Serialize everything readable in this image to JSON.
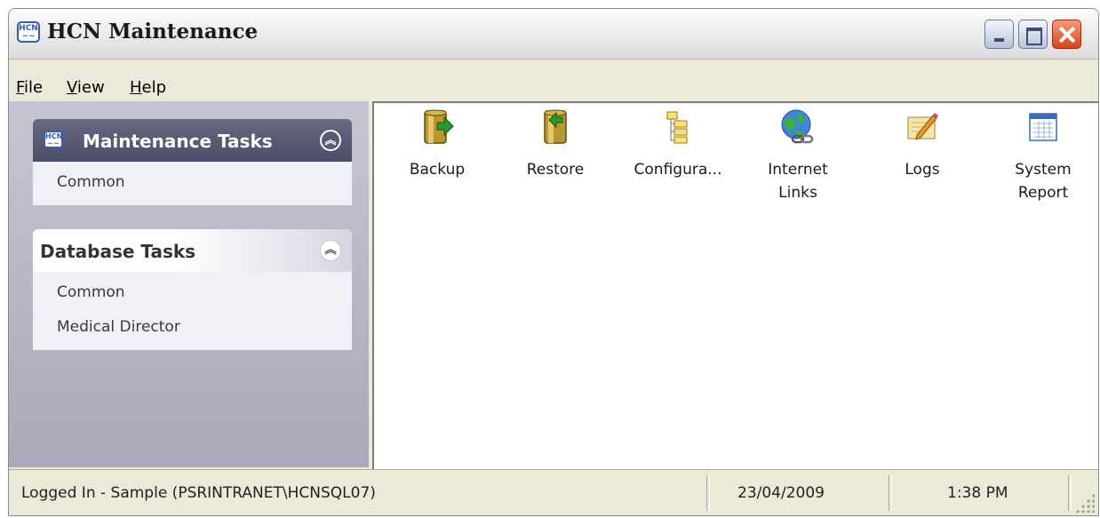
{
  "window": {
    "title": "HCN Maintenance",
    "icon": "hcn-app-icon"
  },
  "menu": {
    "items": [
      {
        "label": "File",
        "mnemonic": "F"
      },
      {
        "label": "View",
        "mnemonic": "V"
      },
      {
        "label": "Help",
        "mnemonic": "H"
      }
    ]
  },
  "sidebar": {
    "panels": [
      {
        "title": "Maintenance Tasks",
        "icon": "hcn-app-icon",
        "items": [
          "Common"
        ]
      },
      {
        "title": "Database Tasks",
        "items": [
          "Common",
          "Medical Director"
        ]
      }
    ]
  },
  "tasks": [
    {
      "label": "Backup",
      "icon": "backup-icon"
    },
    {
      "label": "Restore",
      "icon": "restore-icon"
    },
    {
      "label": "Configura...",
      "icon": "configuration-icon"
    },
    {
      "label": "Internet\nLinks",
      "icon": "internet-links-icon"
    },
    {
      "label": "Logs",
      "icon": "logs-icon"
    },
    {
      "label": "System\nReport",
      "icon": "system-report-icon"
    }
  ],
  "status": {
    "login": "Logged In - Sample (PSRINTRANET\\HCNSQL07)",
    "date": "23/04/2009",
    "time": "1:38 PM"
  },
  "colors": {
    "sidebar_bg": "#b3b3c4",
    "panel_head_dark": "#55566f",
    "close_button": "#d9441a"
  }
}
